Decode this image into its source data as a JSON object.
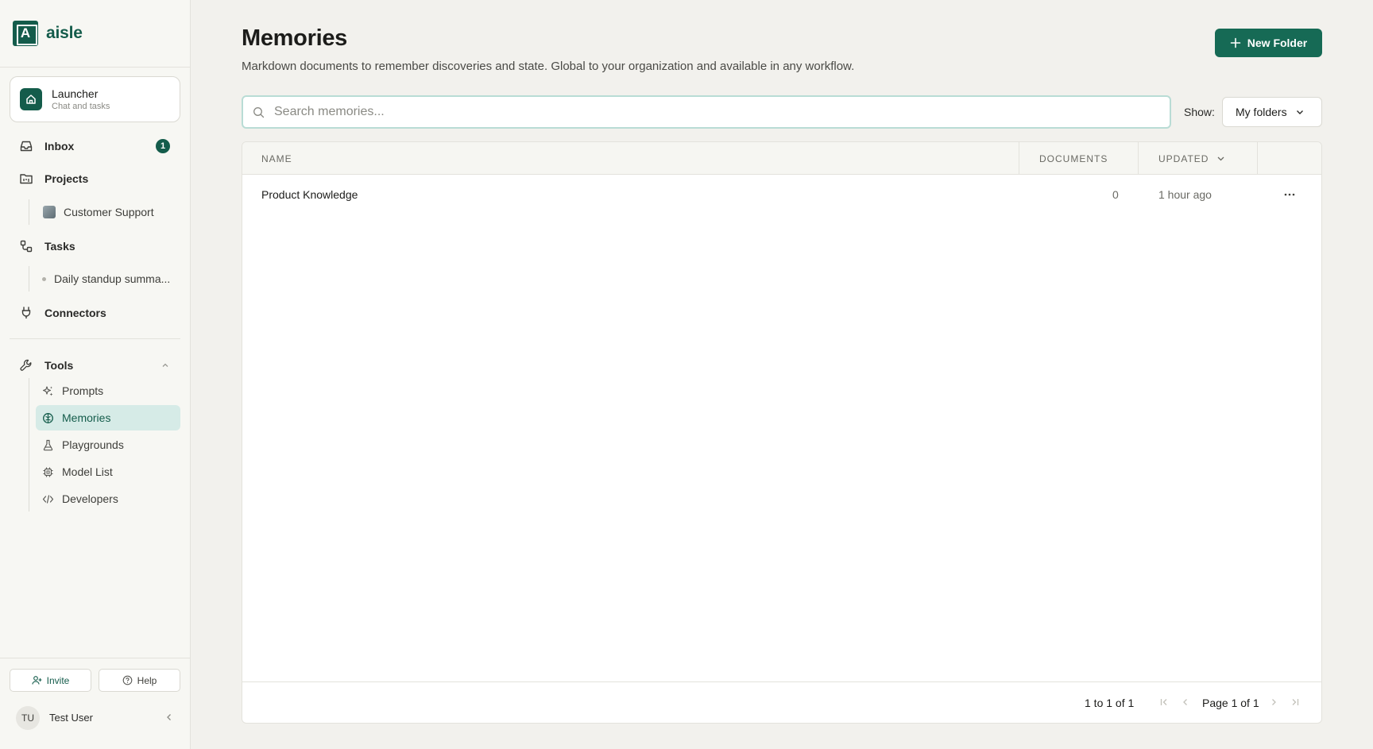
{
  "brand": {
    "name": "aisle",
    "logo_letter": "A"
  },
  "launcher": {
    "title": "Launcher",
    "subtitle": "Chat and tasks"
  },
  "nav": {
    "inbox": {
      "label": "Inbox",
      "badge": "1"
    },
    "projects": {
      "label": "Projects",
      "items": [
        "Customer Support"
      ]
    },
    "tasks": {
      "label": "Tasks",
      "items": [
        "Daily standup summa..."
      ]
    },
    "connectors": {
      "label": "Connectors"
    },
    "tools": {
      "label": "Tools",
      "items": [
        {
          "label": "Prompts",
          "icon": "sparkles-icon"
        },
        {
          "label": "Memories",
          "icon": "brain-icon",
          "active": true
        },
        {
          "label": "Playgrounds",
          "icon": "flask-icon"
        },
        {
          "label": "Model List",
          "icon": "chip-icon"
        },
        {
          "label": "Developers",
          "icon": "code-icon"
        }
      ]
    }
  },
  "footer": {
    "invite": "Invite",
    "help": "Help",
    "user_initials": "TU",
    "user_name": "Test User"
  },
  "page": {
    "title": "Memories",
    "subtitle": "Markdown documents to remember discoveries and state. Global to your organization and available in any workflow.",
    "new_folder": "New Folder",
    "search_placeholder": "Search memories...",
    "show_label": "Show:",
    "show_value": "My folders"
  },
  "table": {
    "columns": {
      "name": "NAME",
      "documents": "DOCUMENTS",
      "updated": "UPDATED"
    },
    "rows": [
      {
        "name": "Product Knowledge",
        "documents": "0",
        "updated": "1 hour ago"
      }
    ],
    "range": "1 to 1 of 1",
    "page_info": "Page 1 of 1"
  },
  "colors": {
    "accent": "#145c4b",
    "accent_light": "#d6ebe7",
    "background": "#f2f1ed"
  }
}
